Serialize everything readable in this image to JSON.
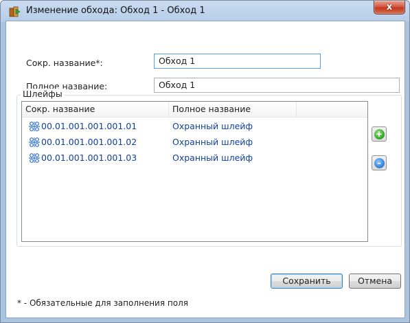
{
  "window": {
    "title": "Изменение обхода: Обход 1 - Обход 1",
    "close_label": "x"
  },
  "form": {
    "short_name_label": "Сокр. название*:",
    "short_name_value": "Обход 1",
    "full_name_label": "Полное название:",
    "full_name_value": "Обход 1"
  },
  "loops": {
    "group_title": "Шлейфы",
    "columns": [
      "Сокр. название",
      "Полное название"
    ],
    "rows": [
      {
        "short": "00.01.001.001.001.01",
        "full": "Охранный шлейф"
      },
      {
        "short": "00.01.001.001.001.02",
        "full": "Охранный шлейф"
      },
      {
        "short": "00.01.001.001.001.03",
        "full": "Охранный шлейф"
      }
    ],
    "add_icon": "plus-circle-icon",
    "remove_icon": "minus-circle-icon"
  },
  "buttons": {
    "save": "Сохранить",
    "cancel": "Отмена"
  },
  "footnote": "* - Обязательные для заполнения поля",
  "colors": {
    "link_text": "#0f3fa0",
    "add_green": "#2fa12a",
    "remove_blue": "#2b7fd4",
    "close_red": "#c2381f"
  }
}
